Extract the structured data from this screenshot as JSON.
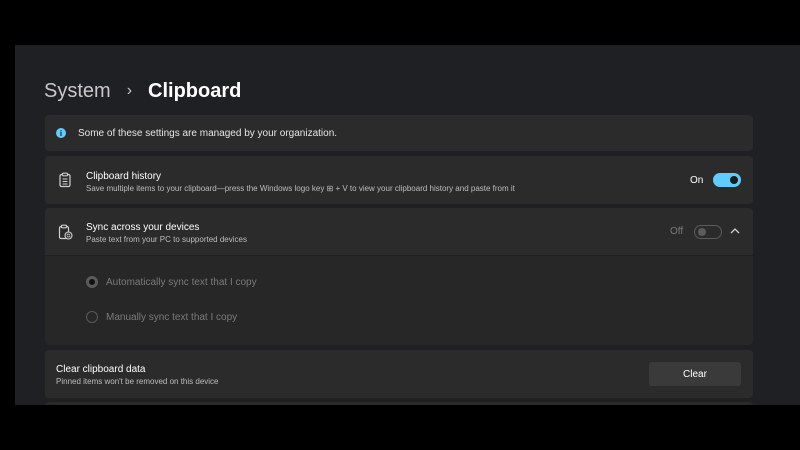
{
  "breadcrumb": {
    "parent": "System",
    "separator": "›",
    "current": "Clipboard"
  },
  "notice": {
    "text": "Some of these settings are managed by your organization."
  },
  "clipboard_history": {
    "title": "Clipboard history",
    "subtitle": "Save multiple items to your clipboard—press the Windows logo key ⊞ + V to view your clipboard history and paste from it",
    "state_label": "On",
    "enabled": true
  },
  "sync": {
    "title": "Sync across your devices",
    "subtitle": "Paste text from your PC to supported devices",
    "state_label": "Off",
    "enabled": false,
    "expanded": true,
    "options": [
      {
        "label": "Automatically sync text that I copy",
        "selected": true
      },
      {
        "label": "Manually sync text that I copy",
        "selected": false
      }
    ]
  },
  "clear_data": {
    "title": "Clear clipboard data",
    "subtitle": "Pinned items won't be removed on this device",
    "button_label": "Clear"
  },
  "colors": {
    "accent": "#60cdff",
    "highlight": "#e02222",
    "card": "#2b2b2b",
    "background": "#1f2024"
  }
}
